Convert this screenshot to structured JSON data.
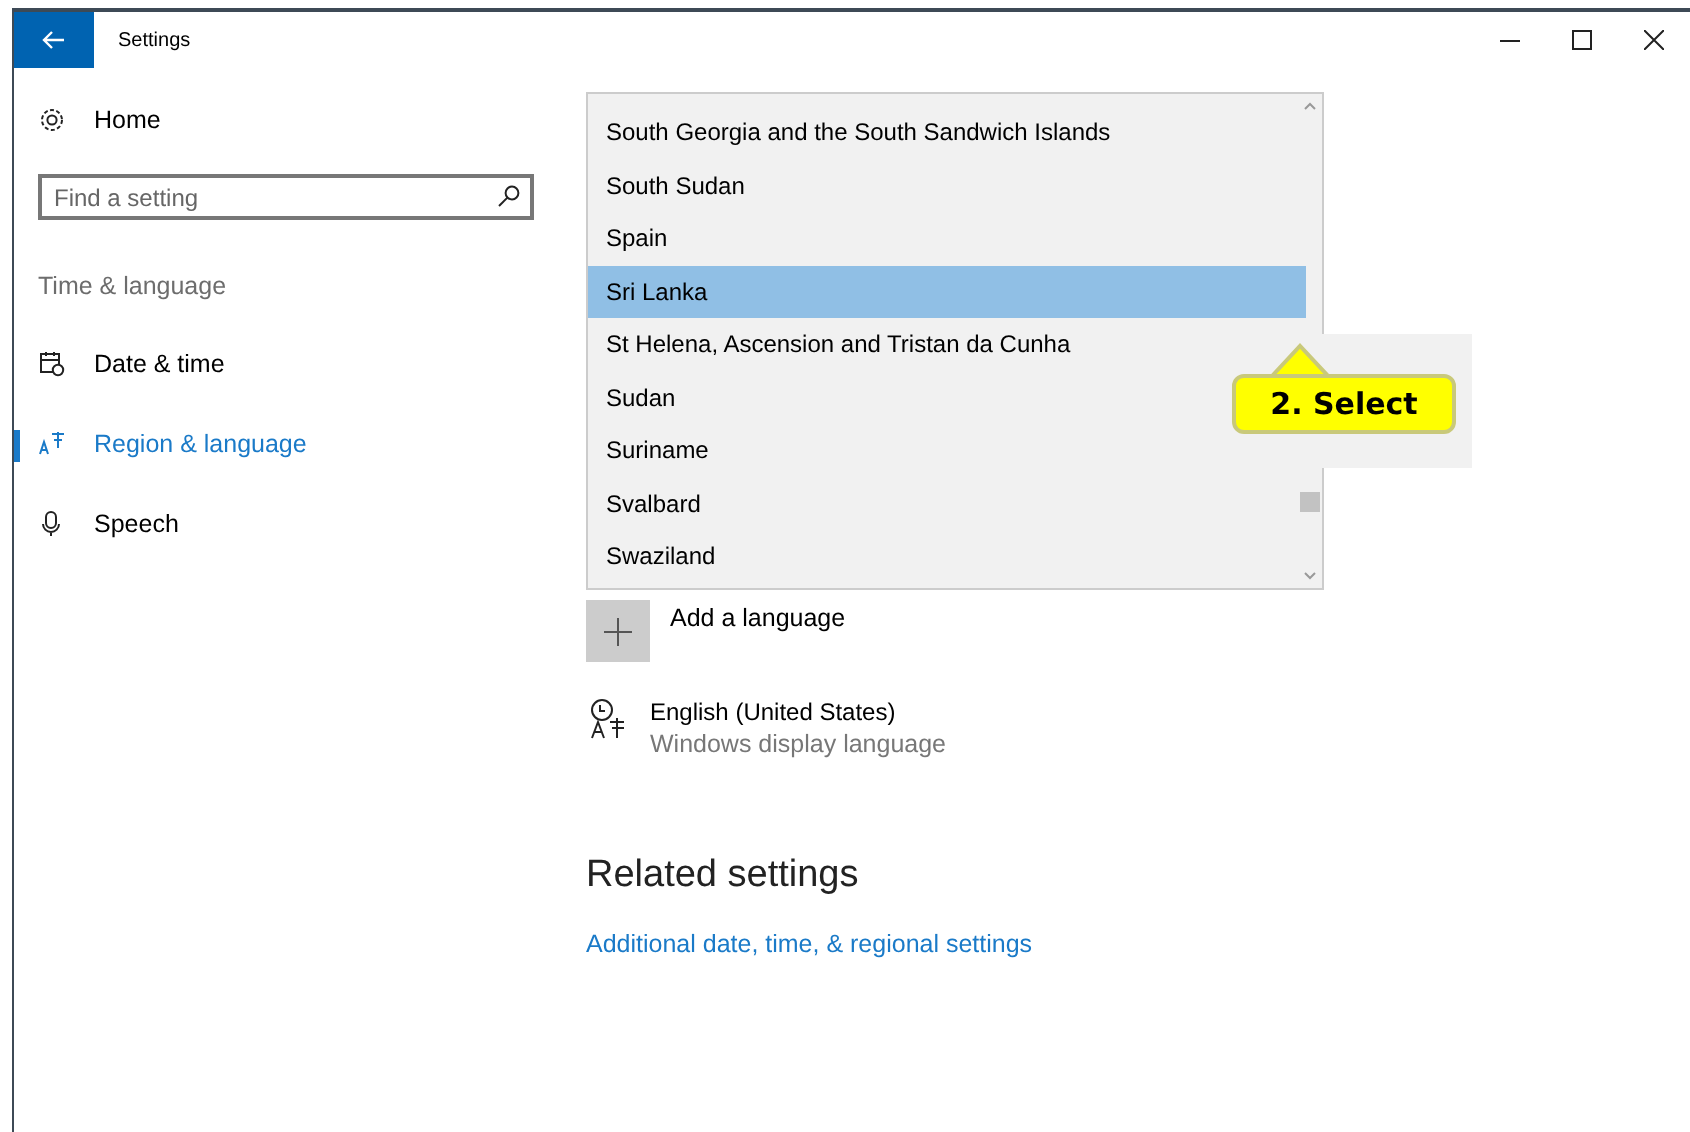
{
  "window": {
    "title": "Settings"
  },
  "sidebar": {
    "home": "Home",
    "search": {
      "placeholder": "Find a setting"
    },
    "section": "Time & language",
    "items": [
      {
        "label": "Date & time",
        "selected": false
      },
      {
        "label": "Region & language",
        "selected": true
      },
      {
        "label": "Speech",
        "selected": false
      }
    ]
  },
  "dropdown": {
    "options": [
      {
        "label": "South Georgia and the South Sandwich Islands",
        "selected": false
      },
      {
        "label": "South Sudan",
        "selected": false
      },
      {
        "label": "Spain",
        "selected": false
      },
      {
        "label": "Sri Lanka",
        "selected": true
      },
      {
        "label": "St Helena, Ascension and Tristan da Cunha",
        "selected": false
      },
      {
        "label": "Sudan",
        "selected": false
      },
      {
        "label": "Suriname",
        "selected": false
      },
      {
        "label": "Svalbard",
        "selected": false
      },
      {
        "label": "Swaziland",
        "selected": false
      }
    ]
  },
  "add_language": "Add a language",
  "language": {
    "name": "English (United States)",
    "detail": "Windows display language"
  },
  "related": {
    "title": "Related settings",
    "link": "Additional date, time, & regional settings"
  },
  "callout": "2. Select"
}
